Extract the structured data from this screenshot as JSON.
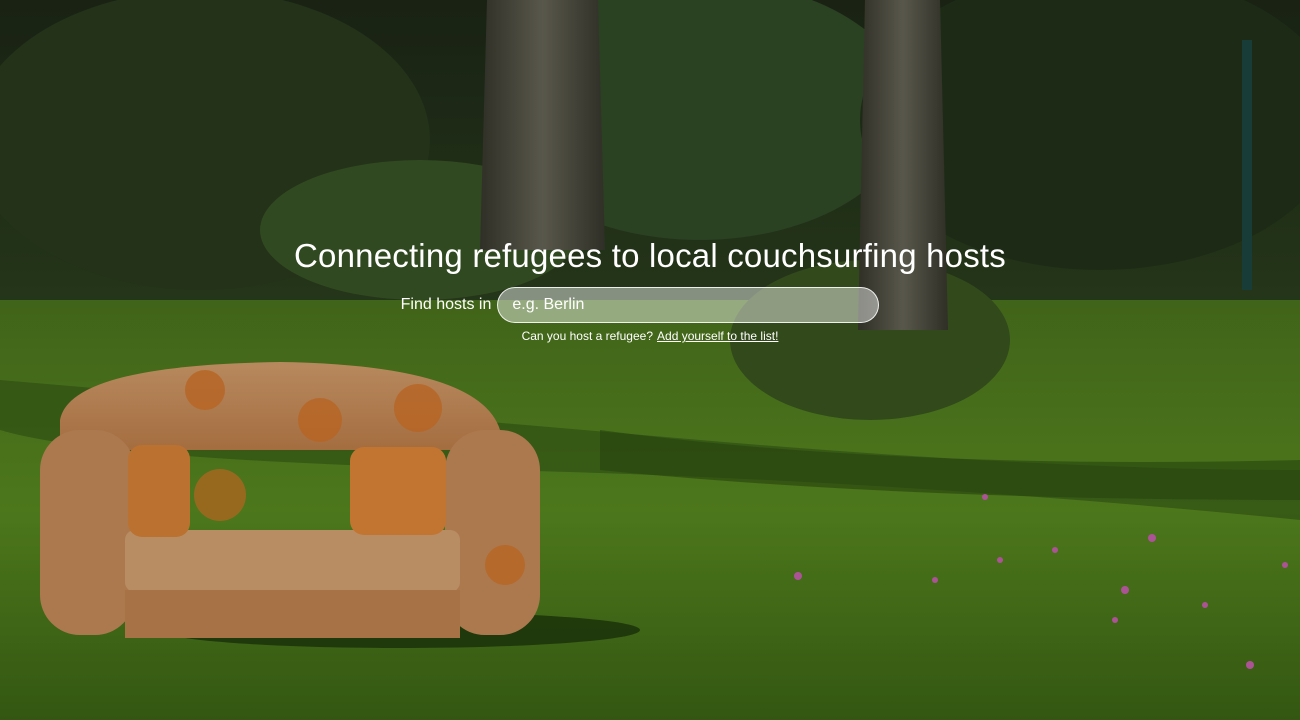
{
  "hero": {
    "headline": "Connecting refugees to local couchsurfing hosts",
    "search": {
      "label": "Find hosts in",
      "placeholder": "e.g. Berlin",
      "value": ""
    },
    "cta": {
      "question": "Can you host a refugee?",
      "link_text": "Add yourself to the list!"
    }
  },
  "colors": {
    "text": "#ffffff",
    "input_border": "#ffffff",
    "grass": "#5a8a1e",
    "foliage": "#23331a"
  }
}
